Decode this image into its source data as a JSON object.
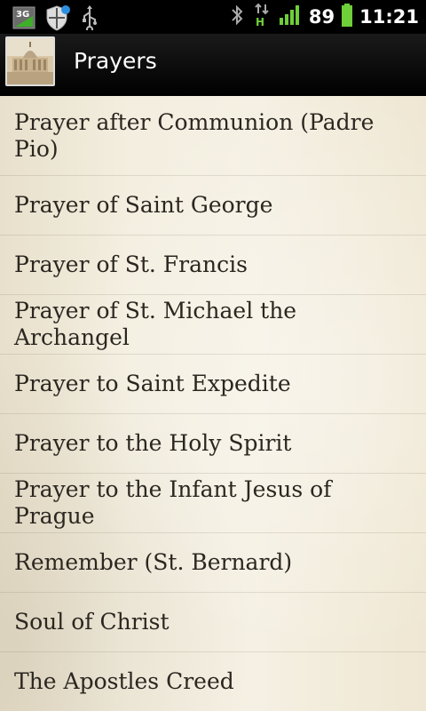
{
  "status_bar": {
    "network_type": "3G",
    "battery_percent": "89",
    "time": "11:21",
    "data_indicator": "H"
  },
  "header": {
    "title": "Prayers"
  },
  "prayers": [
    "Prayer after Communion (Padre Pio)",
    "Prayer of Saint George",
    "Prayer of St. Francis",
    "Prayer of St. Michael the Archangel",
    "Prayer to Saint Expedite",
    "Prayer to the Holy Spirit",
    "Prayer to the Infant Jesus of Prague",
    "Remember (St. Bernard)",
    "Soul of Christ",
    "The Apostles Creed"
  ]
}
